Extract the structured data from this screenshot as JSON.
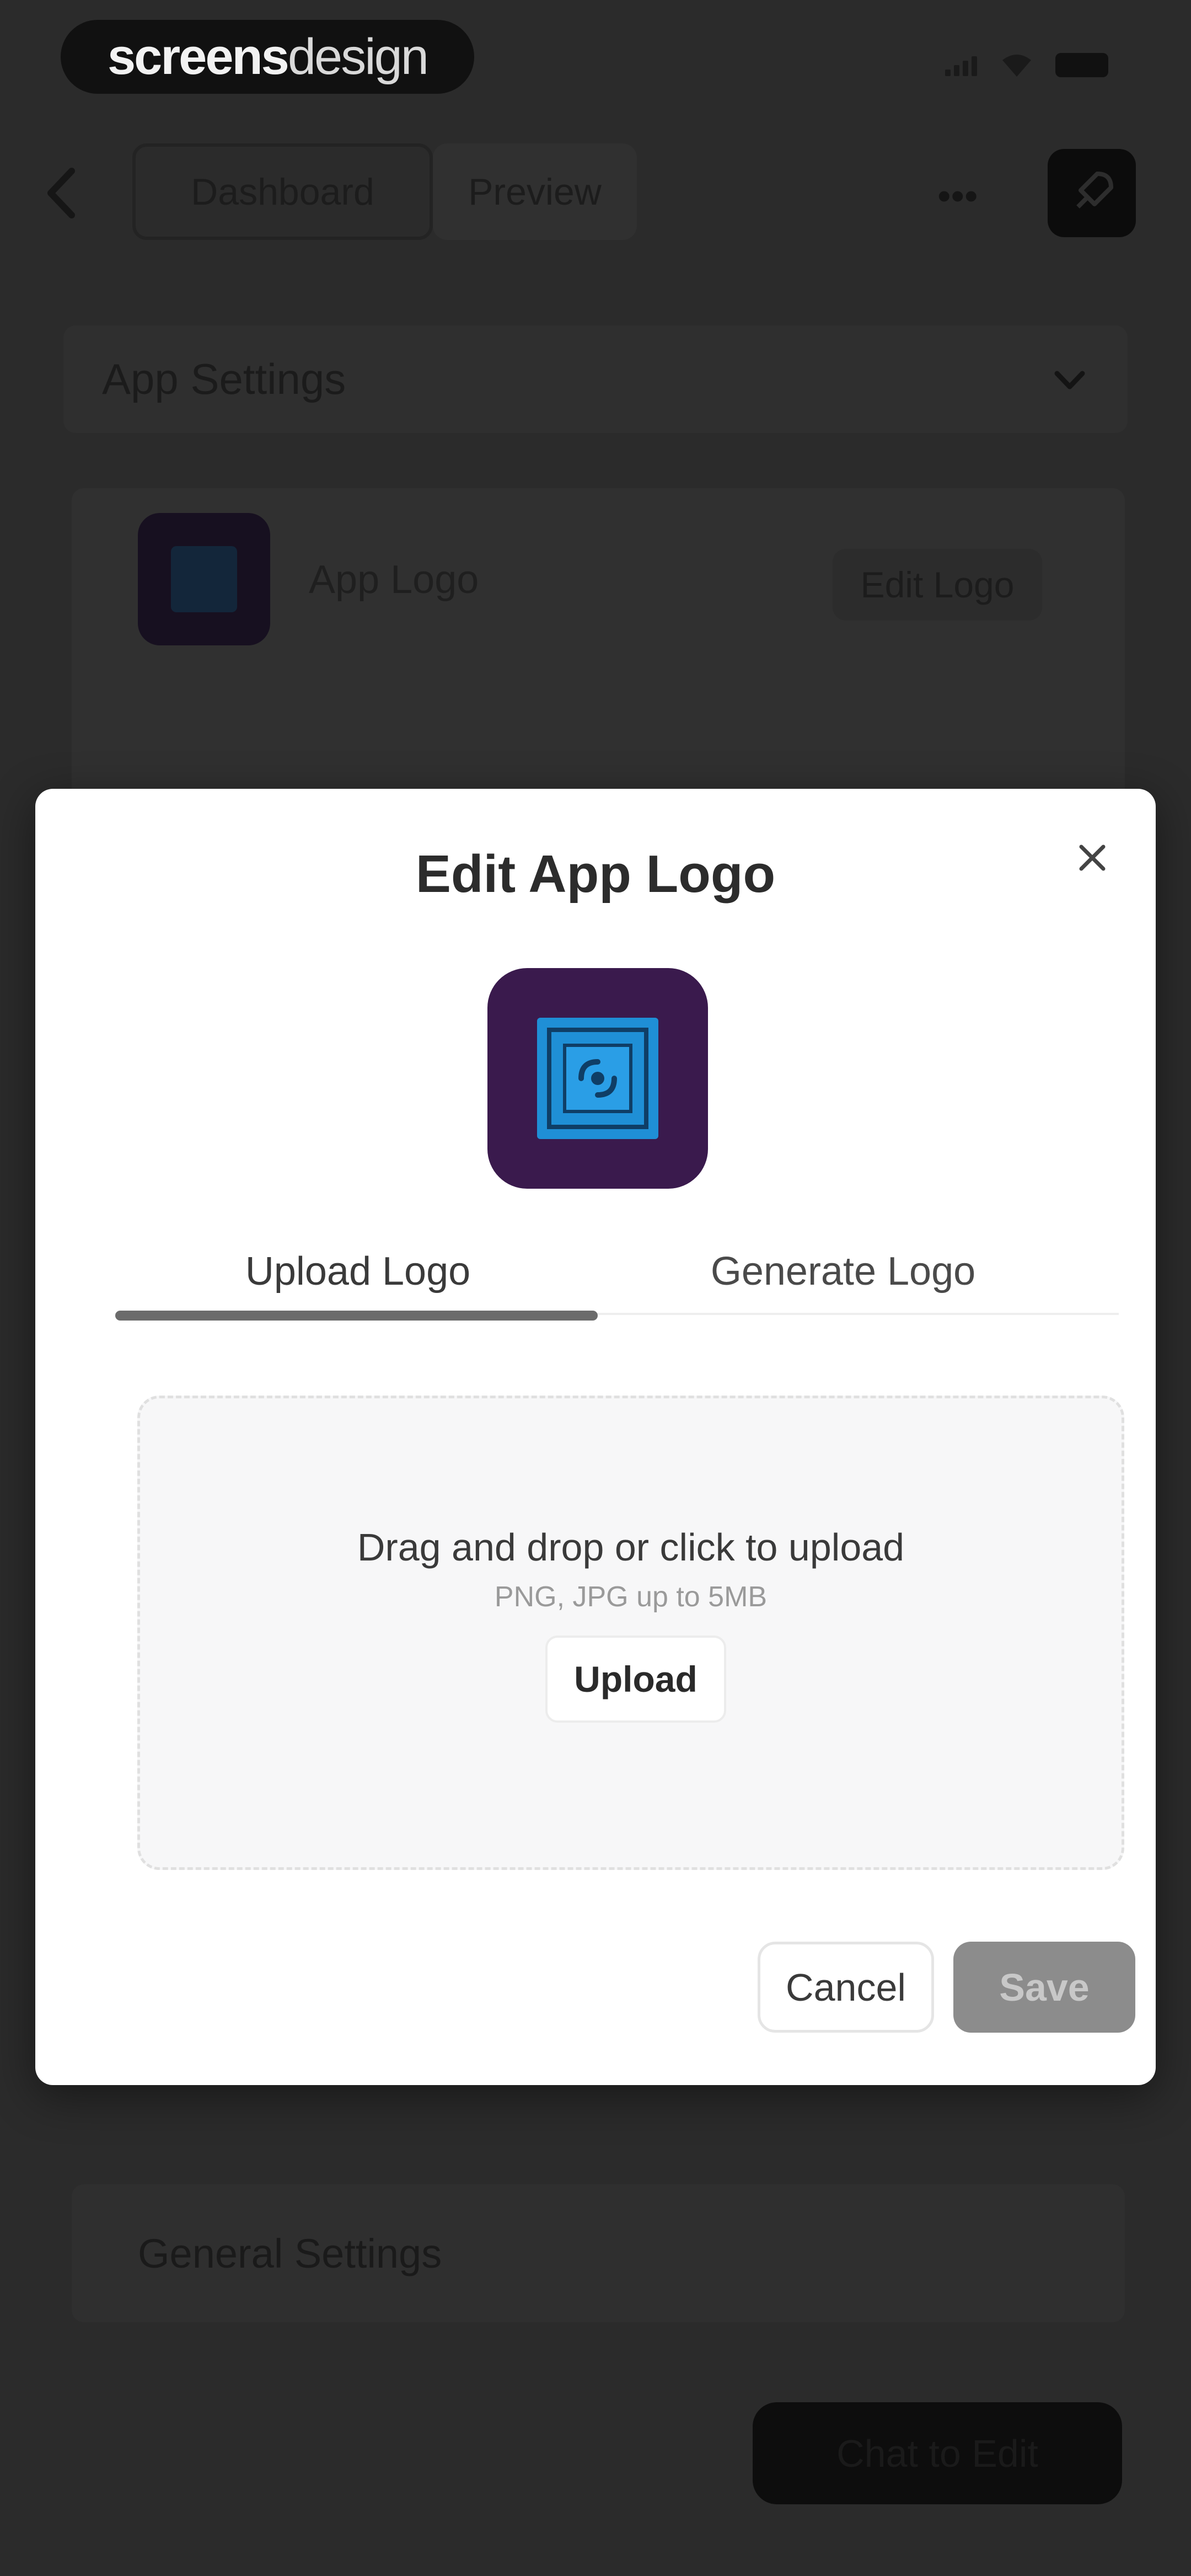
{
  "brand": {
    "bold": "screens",
    "light": "design"
  },
  "nav": {
    "dashboard": "Dashboard",
    "preview": "Preview",
    "more": "•••"
  },
  "settings": {
    "title": "App Settings",
    "logo_label": "App Logo",
    "edit_logo": "Edit Logo",
    "general": "General Settings"
  },
  "chat_button": "Chat to Edit",
  "modal": {
    "title": "Edit App Logo",
    "tabs": [
      {
        "label": "Upload Logo",
        "active": true
      },
      {
        "label": "Generate Logo",
        "active": false
      }
    ],
    "dropzone": {
      "primary": "Drag and drop or click to upload",
      "secondary": "PNG, JPG up to 5MB",
      "button": "Upload"
    },
    "cancel": "Cancel",
    "save": "Save"
  },
  "colors": {
    "logo_bg": "#3a1a4d",
    "logo_fg": "#1f8fd6",
    "overlay": "#2b2b2b"
  }
}
